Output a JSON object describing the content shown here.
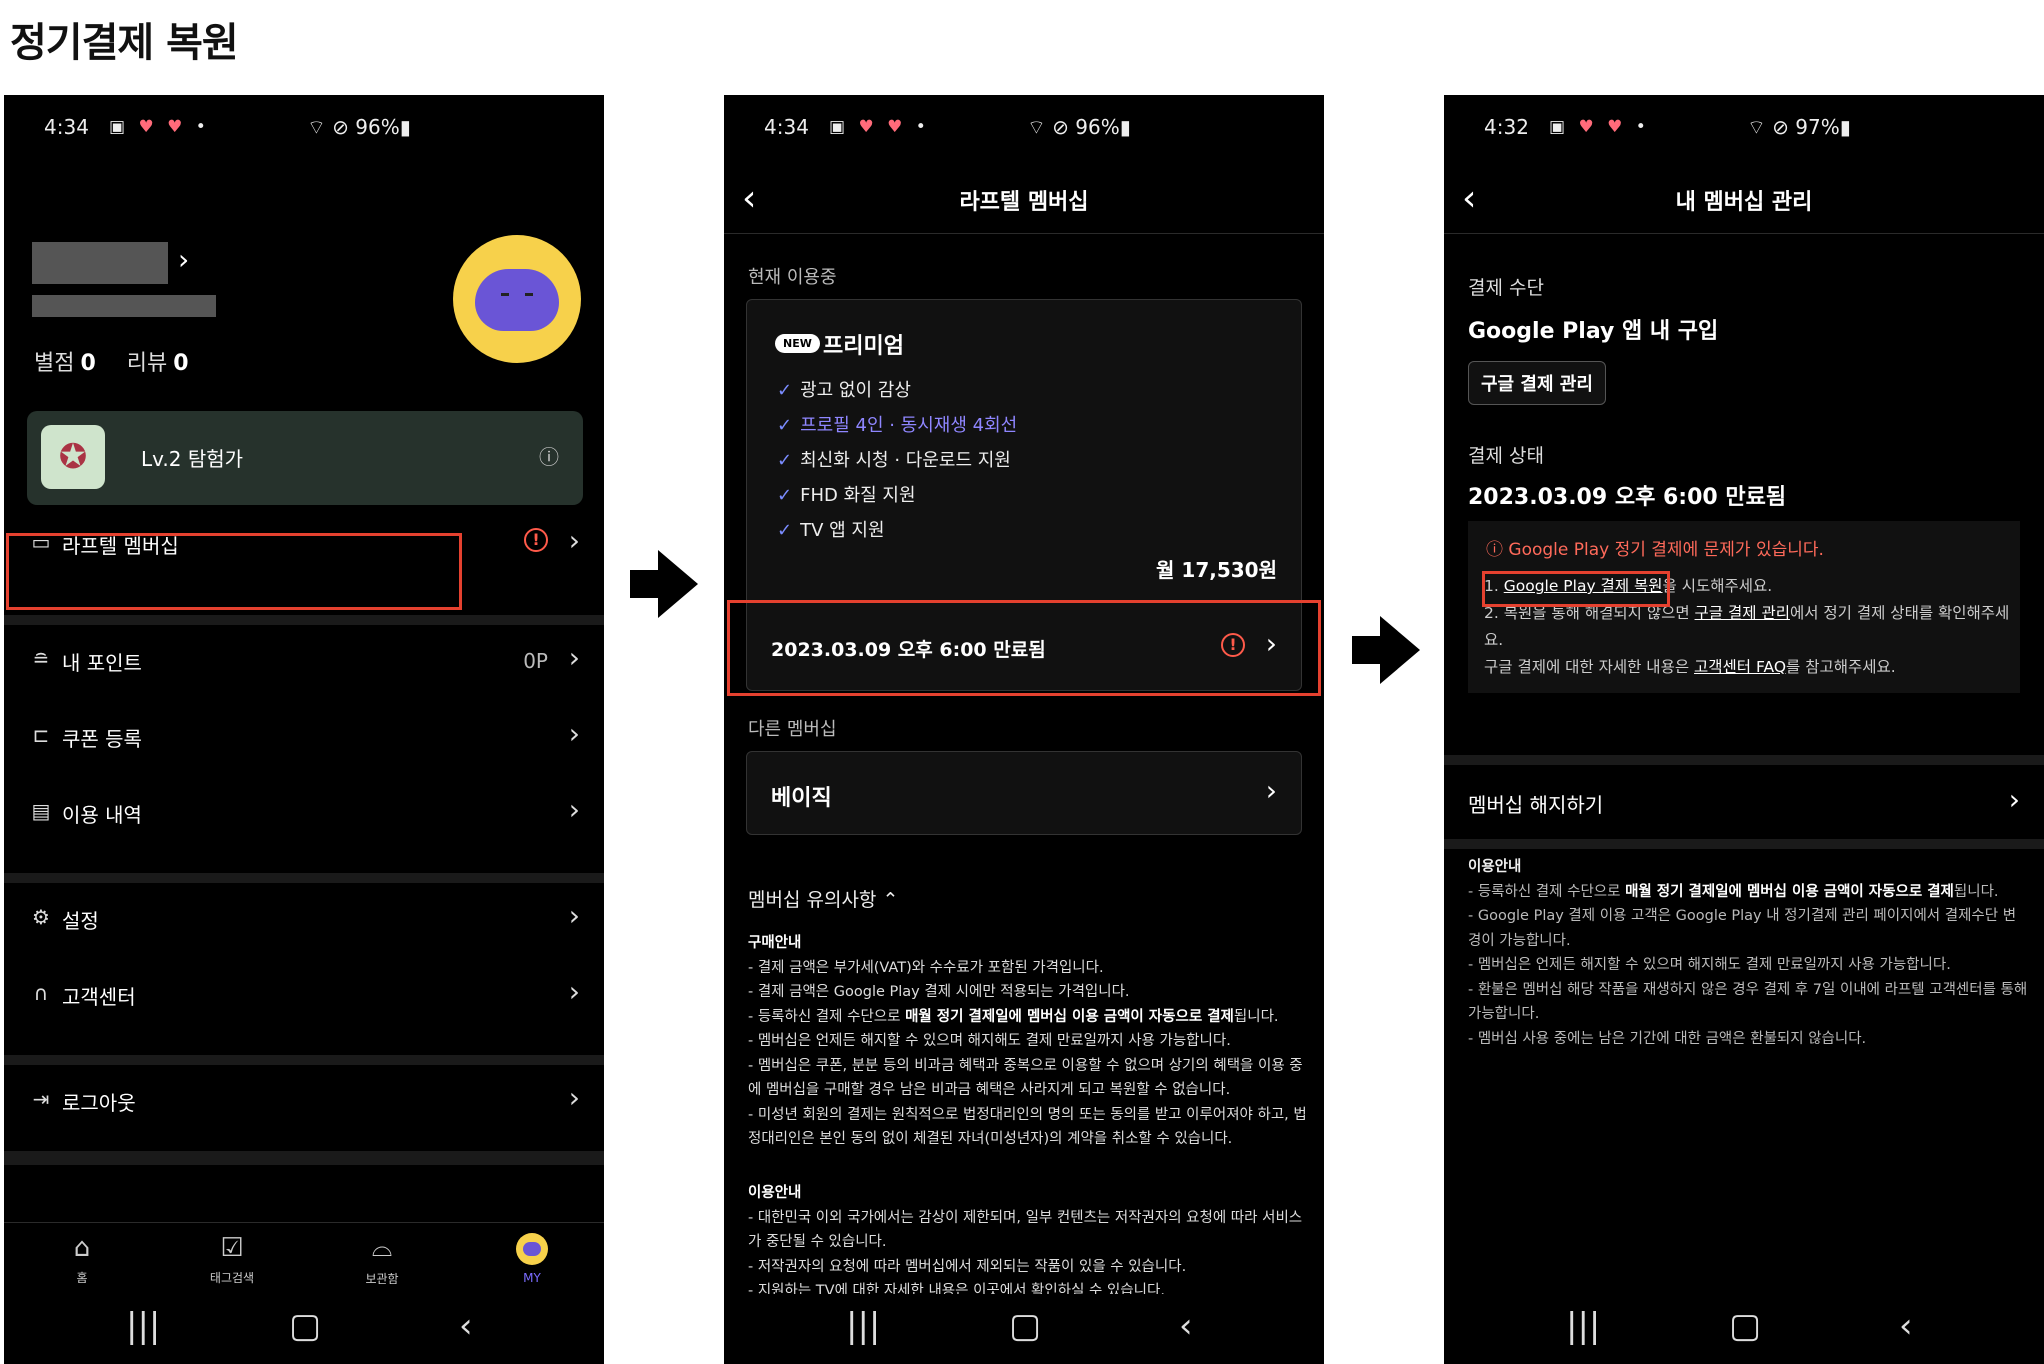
{
  "page": {
    "title": "정기결제 복원"
  },
  "screen1": {
    "status": {
      "time": "4:34",
      "battery": "96%"
    },
    "stats": {
      "rating_label": "별점",
      "rating_value": "0",
      "review_label": "리뷰",
      "review_value": "0"
    },
    "level": {
      "text": "Lv.2 탐험가"
    },
    "menu": [
      {
        "icon": "card-icon",
        "label": "라프텔 멤버십"
      },
      {
        "icon": "coin-stack-icon",
        "label": "내 포인트",
        "value": "0P"
      },
      {
        "icon": "ticket-icon",
        "label": "쿠폰 등록"
      },
      {
        "icon": "document-icon",
        "label": "이용 내역"
      },
      {
        "icon": "gear-icon",
        "label": "설정"
      },
      {
        "icon": "headset-icon",
        "label": "고객센터"
      },
      {
        "icon": "logout-icon",
        "label": "로그아웃"
      }
    ],
    "tabs": [
      {
        "icon": "home-icon",
        "label": "홈"
      },
      {
        "icon": "checkbox-icon",
        "label": "태그검색"
      },
      {
        "icon": "inbox-icon",
        "label": "보관함"
      },
      {
        "icon": "avatar-icon",
        "label": "MY"
      }
    ],
    "colors": {
      "accent": "#7b6cff",
      "alert": "#ff5a4a",
      "highlight": "#e5412f",
      "level_bg": "#26322c",
      "avatar_bg": "#f7d14b"
    }
  },
  "screen2": {
    "status": {
      "time": "4:34",
      "battery": "96%"
    },
    "header_title": "라프텔 멤버십",
    "current_label": "현재 이용중",
    "plan": {
      "badge": "NEW",
      "name": "프리미엄",
      "features": [
        "광고 없이 감상",
        "프로필 4인 · 동시재생 4회선",
        "최신화 시청 · 다운로드 지원",
        "FHD 화질 지원",
        "TV 앱 지원"
      ],
      "price": "월 17,530원",
      "expire": "2023.03.09 오후 6:00 만료됨"
    },
    "other_label": "다른 멤버십",
    "other_plan": "베이직",
    "notice_title": "멤버십 유의사항 ⌃",
    "purchase_heading": "구매안내",
    "purchase_lines": [
      "- 결제 금액은 부가세(VAT)와 수수료가 포함된 가격입니다.",
      "- 결제 금액은 Google Play 결제 시에만 적용되는 가격입니다.",
      "- 등록하신 결제 수단으로 ",
      "매월 정기 결제일에 멤버십 이용 금액이 자동으로 결제",
      "됩니다.",
      "- 멤버십은 언제든 해지할 수 있으며 해지해도 결제 만료일까지 사용 가능합니다.",
      "- 멤버십은 쿠폰, 분분 등의 비과금 혜택과 중복으로 이용할 수 없으며 상기의 혜택을 이용 중에 멤버십을 구매할 경우 남은 비과금 혜택은 사라지게 되고 복원할 수 없습니다.",
      "- 미성년 회원의 결제는 원칙적으로 법정대리인의 명의 또는 동의를 받고 이루어져야 하고, 법정대리인은 본인 동의 없이 체결된 자녀(미성년자)의 계약을 취소할 수 있습니다."
    ],
    "usage_heading": "이용안내",
    "usage_lines": [
      "- 대한민국 이외 국가에서는 감상이 제한되며, 일부 컨텐츠는 저작권자의 요청에 따라 서비스가 중단될 수 있습니다.",
      "- 저작권자의 요청에 따라 멤버십에서 제외되는 작품이 있을 수 있습니다.",
      "- 지원하는 TV에 대한 자세한 내용은 이곳에서 확인하실 수 있습니다."
    ]
  },
  "screen3": {
    "status": {
      "time": "4:32",
      "battery": "97%"
    },
    "header_title": "내 멤버십 관리",
    "method_label": "결제 수단",
    "method_value": "Google Play 앱 내 구입",
    "manage_button": "구글 결제 관리",
    "status_label": "결제 상태",
    "status_value": "2023.03.09 오후 6:00 만료됨",
    "warning_title": "ⓘ Google Play 정기 결제에 문제가 있습니다.",
    "warning": {
      "l1_prefix": "1. ",
      "l1_link": "Google Play 결제 복원",
      "l1_suffix": "을 시도해주세요.",
      "l2_prefix": "2. 복원을 통해 해결되지 않으면 ",
      "l2_link": "구글 결제 관리",
      "l2_suffix": "에서 정기 결제 상태를 확인해주세요.",
      "l3_prefix": "구글 결제에 대한 자세한 내용은 ",
      "l3_link": "고객센터 FAQ",
      "l3_suffix": "를 참고해주세요."
    },
    "cancel_label": "멤버십 해지하기",
    "info_heading": "이용안내",
    "info": {
      "i1_prefix": "- 등록하신 결제 수단으로 ",
      "i1_bold": "매월 정기 결제일에 멤버십 이용 금액이 자동으로 결제",
      "i1_suffix": "됩니다.",
      "i2": "- Google Play 결제 이용 고객은 Google Play 내 정기결제 관리 페이지에서 결제수단 변경이 가능합니다.",
      "i3": "- 멤버십은 언제든 해지할 수 있으며 해지해도 결제 만료일까지 사용 가능합니다.",
      "i4": "- 환불은 멤버십 해당 작품을 재생하지 않은 경우 결제 후 7일 이내에 라프텔 고객센터를 통해 가능합니다.",
      "i5": "- 멤버십 사용 중에는 남은 기간에 대한 금액은 환불되지 않습니다."
    }
  }
}
